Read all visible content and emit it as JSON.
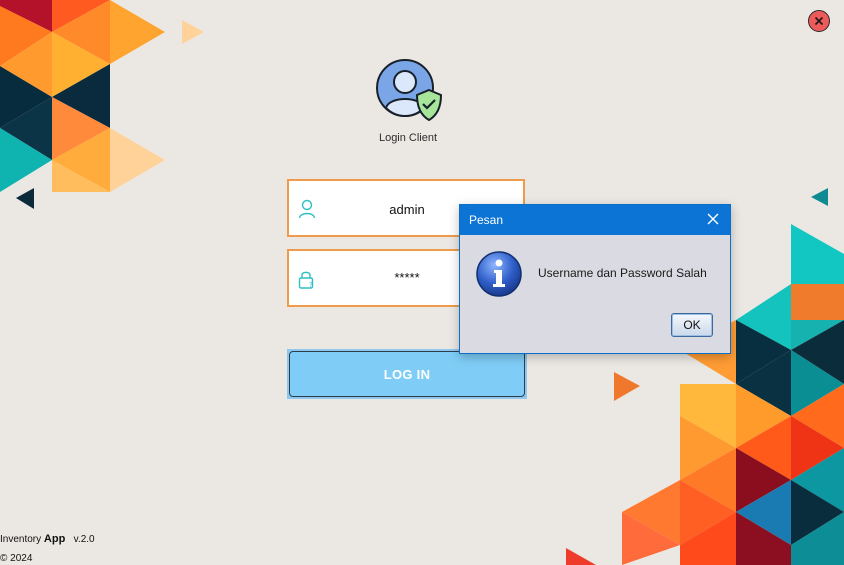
{
  "app": {
    "title": "Login Client",
    "footer_name": "Inventory",
    "footer_brand": "App",
    "footer_version": "v.2.0",
    "footer_copyright": "© 2024"
  },
  "form": {
    "username_value": "admin",
    "password_value": "*****",
    "login_button_label": "LOG IN"
  },
  "dialog": {
    "title": "Pesan",
    "message": "Username dan Password Salah",
    "ok_label": "OK"
  },
  "icons": {
    "close": "close-icon",
    "avatar": "user-shield-icon",
    "username": "user-icon",
    "password": "lock-icon",
    "info": "info-icon"
  },
  "colors": {
    "background": "#ebe8e4",
    "field_border": "#ee9b4b",
    "login_button": "#7fcdf6",
    "dialog_titlebar": "#0b74d4",
    "close_button": "#ec5a5a"
  }
}
